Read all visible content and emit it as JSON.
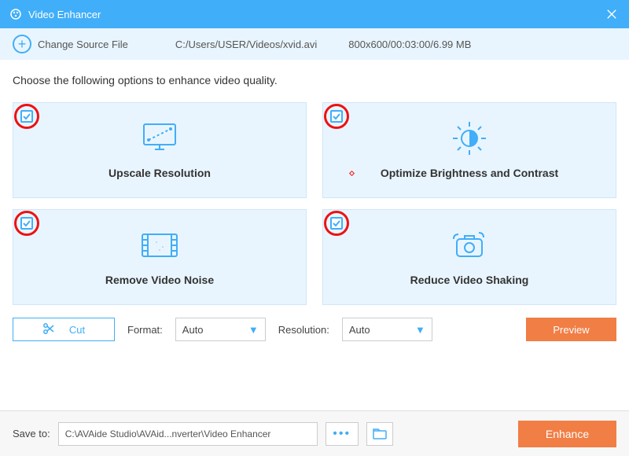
{
  "titlebar": {
    "title": "Video Enhancer"
  },
  "source": {
    "change_label": "Change Source File",
    "path": "C:/Users/USER/Videos/xvid.avi",
    "info": "800x600/00:03:00/6.99 MB"
  },
  "instruction": "Choose the following options to enhance video quality.",
  "cards": [
    {
      "label": "Upscale Resolution"
    },
    {
      "label": "Optimize Brightness and Contrast"
    },
    {
      "label": "Remove Video Noise"
    },
    {
      "label": "Reduce Video Shaking"
    }
  ],
  "controls": {
    "cut_label": "Cut",
    "format_label": "Format:",
    "format_value": "Auto",
    "resolution_label": "Resolution:",
    "resolution_value": "Auto",
    "preview_label": "Preview"
  },
  "footer": {
    "save_label": "Save to:",
    "save_path": "C:\\AVAide Studio\\AVAid...nverter\\Video Enhancer",
    "enhance_label": "Enhance"
  }
}
